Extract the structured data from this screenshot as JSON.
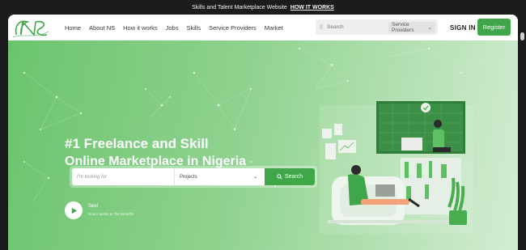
{
  "topbar": {
    "text": "Skills and Talent Marketplace Website",
    "link": "HOW IT WORKS"
  },
  "nav": {
    "items": [
      "Home",
      "About NS",
      "How it works",
      "Jobs",
      "Skills",
      "Service Providers",
      "Market"
    ],
    "search_placeholder": "Search",
    "search_filter": "Service Providers",
    "signin": "SIGN IN",
    "register": "Register"
  },
  "hero": {
    "headline_1": "#1 Freelance and Skill",
    "headline_2": "Online Marketplace in Nigeria",
    "search_placeholder": "I'm looking for",
    "search_category": "Projects",
    "search_button": "Search",
    "video_title": "See!",
    "video_sub": "How it works & The Benefits"
  },
  "colors": {
    "brand_green": "#3fa64a",
    "hero_green": "#6bc46d"
  }
}
